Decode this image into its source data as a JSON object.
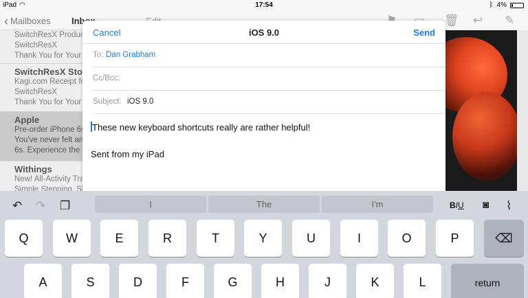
{
  "status": {
    "carrier": "iPad",
    "time": "17:54",
    "battery": "4%"
  },
  "mail_list": {
    "back_label": "Mailboxes",
    "title": "Inbox",
    "edit_label": "Edit",
    "items": [
      {
        "from": "",
        "lines": [
          "SwitchResX Product",
          "SwitchResX",
          "Thank You for Your"
        ]
      },
      {
        "from": "SwitchResX Store",
        "lines": [
          "Kagi.com Receipt for",
          "SwitchResX",
          "Thank You for Your"
        ]
      },
      {
        "from": "Apple",
        "lines": [
          "Pre-order iPhone 6s",
          "You've never felt an",
          "6s. Experience the"
        ]
      },
      {
        "from": "Withings",
        "lines": [
          "New! All-Activity Tra",
          "Simple Stepping. Sl"
        ]
      }
    ]
  },
  "compose": {
    "cancel": "Cancel",
    "title": "iOS 9.0",
    "send": "Send",
    "to_label": "To:",
    "to_value": "Dan Grabham",
    "ccbcc_label": "Cc/Bcc:",
    "subject_label": "Subject:",
    "subject_value": "iOS 9.0",
    "body": "These new keyboard shortcuts really are rather helpful!",
    "signature": "Sent from my iPad"
  },
  "keyboard": {
    "suggestions": [
      "I",
      "The",
      "I'm"
    ],
    "format_label": "BIU",
    "row1": [
      "Q",
      "W",
      "E",
      "R",
      "T",
      "Y",
      "U",
      "I",
      "O",
      "P"
    ],
    "row2": [
      "A",
      "S",
      "D",
      "F",
      "G",
      "H",
      "J",
      "K",
      "L"
    ],
    "return_label": "return",
    "icons": [
      "undo-icon",
      "redo-icon",
      "paste-icon",
      "camera-icon",
      "attachment-icon",
      "delete-icon"
    ]
  }
}
